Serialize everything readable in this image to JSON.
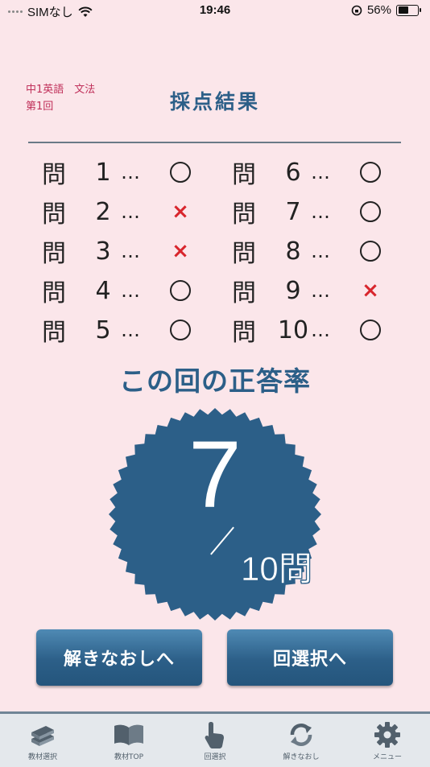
{
  "status_bar": {
    "carrier": "SIMなし",
    "time": "19:46",
    "battery": "56%",
    "battery_fraction": 0.56
  },
  "header": {
    "subject_line1": "中1英語　文法",
    "subject_line2": "第1回",
    "title": "採点結果"
  },
  "results": [
    {
      "q": "問",
      "num": "1",
      "sep": "…",
      "mark": "○",
      "correct": true
    },
    {
      "q": "問",
      "num": "2",
      "sep": "…",
      "mark": "×",
      "correct": false
    },
    {
      "q": "問",
      "num": "3",
      "sep": "…",
      "mark": "×",
      "correct": false
    },
    {
      "q": "問",
      "num": "4",
      "sep": "…",
      "mark": "○",
      "correct": true
    },
    {
      "q": "問",
      "num": "5",
      "sep": "…",
      "mark": "○",
      "correct": true
    },
    {
      "q": "問",
      "num": "6",
      "sep": "…",
      "mark": "○",
      "correct": true
    },
    {
      "q": "問",
      "num": "7",
      "sep": "…",
      "mark": "○",
      "correct": true
    },
    {
      "q": "問",
      "num": "8",
      "sep": "…",
      "mark": "○",
      "correct": true
    },
    {
      "q": "問",
      "num": "9",
      "sep": "…",
      "mark": "×",
      "correct": false
    },
    {
      "q": "問",
      "num": "10",
      "sep": "…",
      "mark": "○",
      "correct": true
    }
  ],
  "score": {
    "title": "この回の正答率",
    "correct": "7",
    "total": "10問"
  },
  "buttons": {
    "review": "解きなおしへ",
    "select": "回選択へ"
  },
  "tabbar": {
    "items": [
      {
        "label": "教材選択",
        "icon": "books-icon"
      },
      {
        "label": "教材TOP",
        "icon": "open-book-icon"
      },
      {
        "label": "回選択",
        "icon": "pointing-hand-icon"
      },
      {
        "label": "解きなおし",
        "icon": "refresh-icon"
      },
      {
        "label": "メニュー",
        "icon": "gear-icon"
      }
    ]
  },
  "colors": {
    "background": "#fbe6ea",
    "accent": "#2c5f88",
    "wrong": "#d8252c",
    "subject": "#c0305a"
  }
}
